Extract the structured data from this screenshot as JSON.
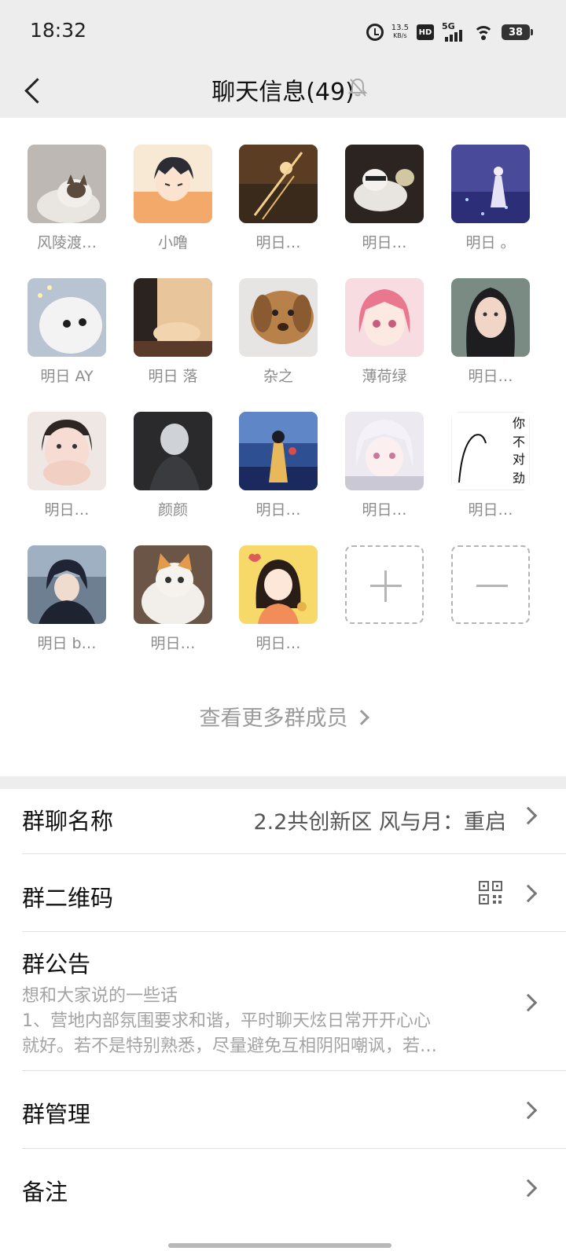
{
  "status_bar": {
    "time": "18:32",
    "net_speed_value": "13.5",
    "net_speed_unit": "KB/s",
    "hd_label": "HD",
    "network_label": "5G",
    "battery": "38"
  },
  "header": {
    "title": "聊天信息(49)",
    "icons": {
      "back": "chevron-left-icon",
      "mute": "bell-off-icon"
    }
  },
  "members": {
    "items": [
      {
        "name": "风陵渡…",
        "avatar": "ragdoll-cat"
      },
      {
        "name": "小噜",
        "avatar": "anime-boy-orange"
      },
      {
        "name": "明日…",
        "avatar": "night-street-lights"
      },
      {
        "name": "明日…",
        "avatar": "cats-with-sunglasses"
      },
      {
        "name": "明日 。",
        "avatar": "purple-night-field"
      },
      {
        "name": "明日 AY",
        "avatar": "white-kitten"
      },
      {
        "name": "明日 落",
        "avatar": "hands-sweater"
      },
      {
        "name": "杂之",
        "avatar": "brown-puppy"
      },
      {
        "name": "薄荷绿",
        "avatar": "pink-hair-anime-girl"
      },
      {
        "name": "明日…",
        "avatar": "dark-hair-girl"
      },
      {
        "name": "明日…",
        "avatar": "girl-covering-face"
      },
      {
        "name": "颜颜",
        "avatar": "dark-portrait"
      },
      {
        "name": "明日…",
        "avatar": "girl-by-sea"
      },
      {
        "name": "明日…",
        "avatar": "white-hair-anime"
      },
      {
        "name": "明日…",
        "avatar": "doodle-text"
      },
      {
        "name": "明日 b…",
        "avatar": "anime-boy-dark"
      },
      {
        "name": "明日…",
        "avatar": "orange-cat"
      },
      {
        "name": "明日…",
        "avatar": "cartoon-girl-yellow"
      }
    ],
    "doodle_text": "你不对劲",
    "add_icon": "plus-icon",
    "remove_icon": "minus-icon",
    "more_label": "查看更多群成员"
  },
  "settings": {
    "group_name_label": "群聊名称",
    "group_name_value": "2.2共创新区 风与月：重启",
    "qr_label": "群二维码",
    "qr_icon": "qr-code-icon",
    "notice_label": "群公告",
    "notice_line1": "想和大家说的一些话",
    "notice_line2": "1、营地内部氛围要求和谐，平时聊天炫日常开开心心",
    "notice_line3": "就好。若不是特别熟悉，尽量避免互相阴阳嘲讽，若…",
    "manage_label": "群管理",
    "remark_label": "备注"
  }
}
